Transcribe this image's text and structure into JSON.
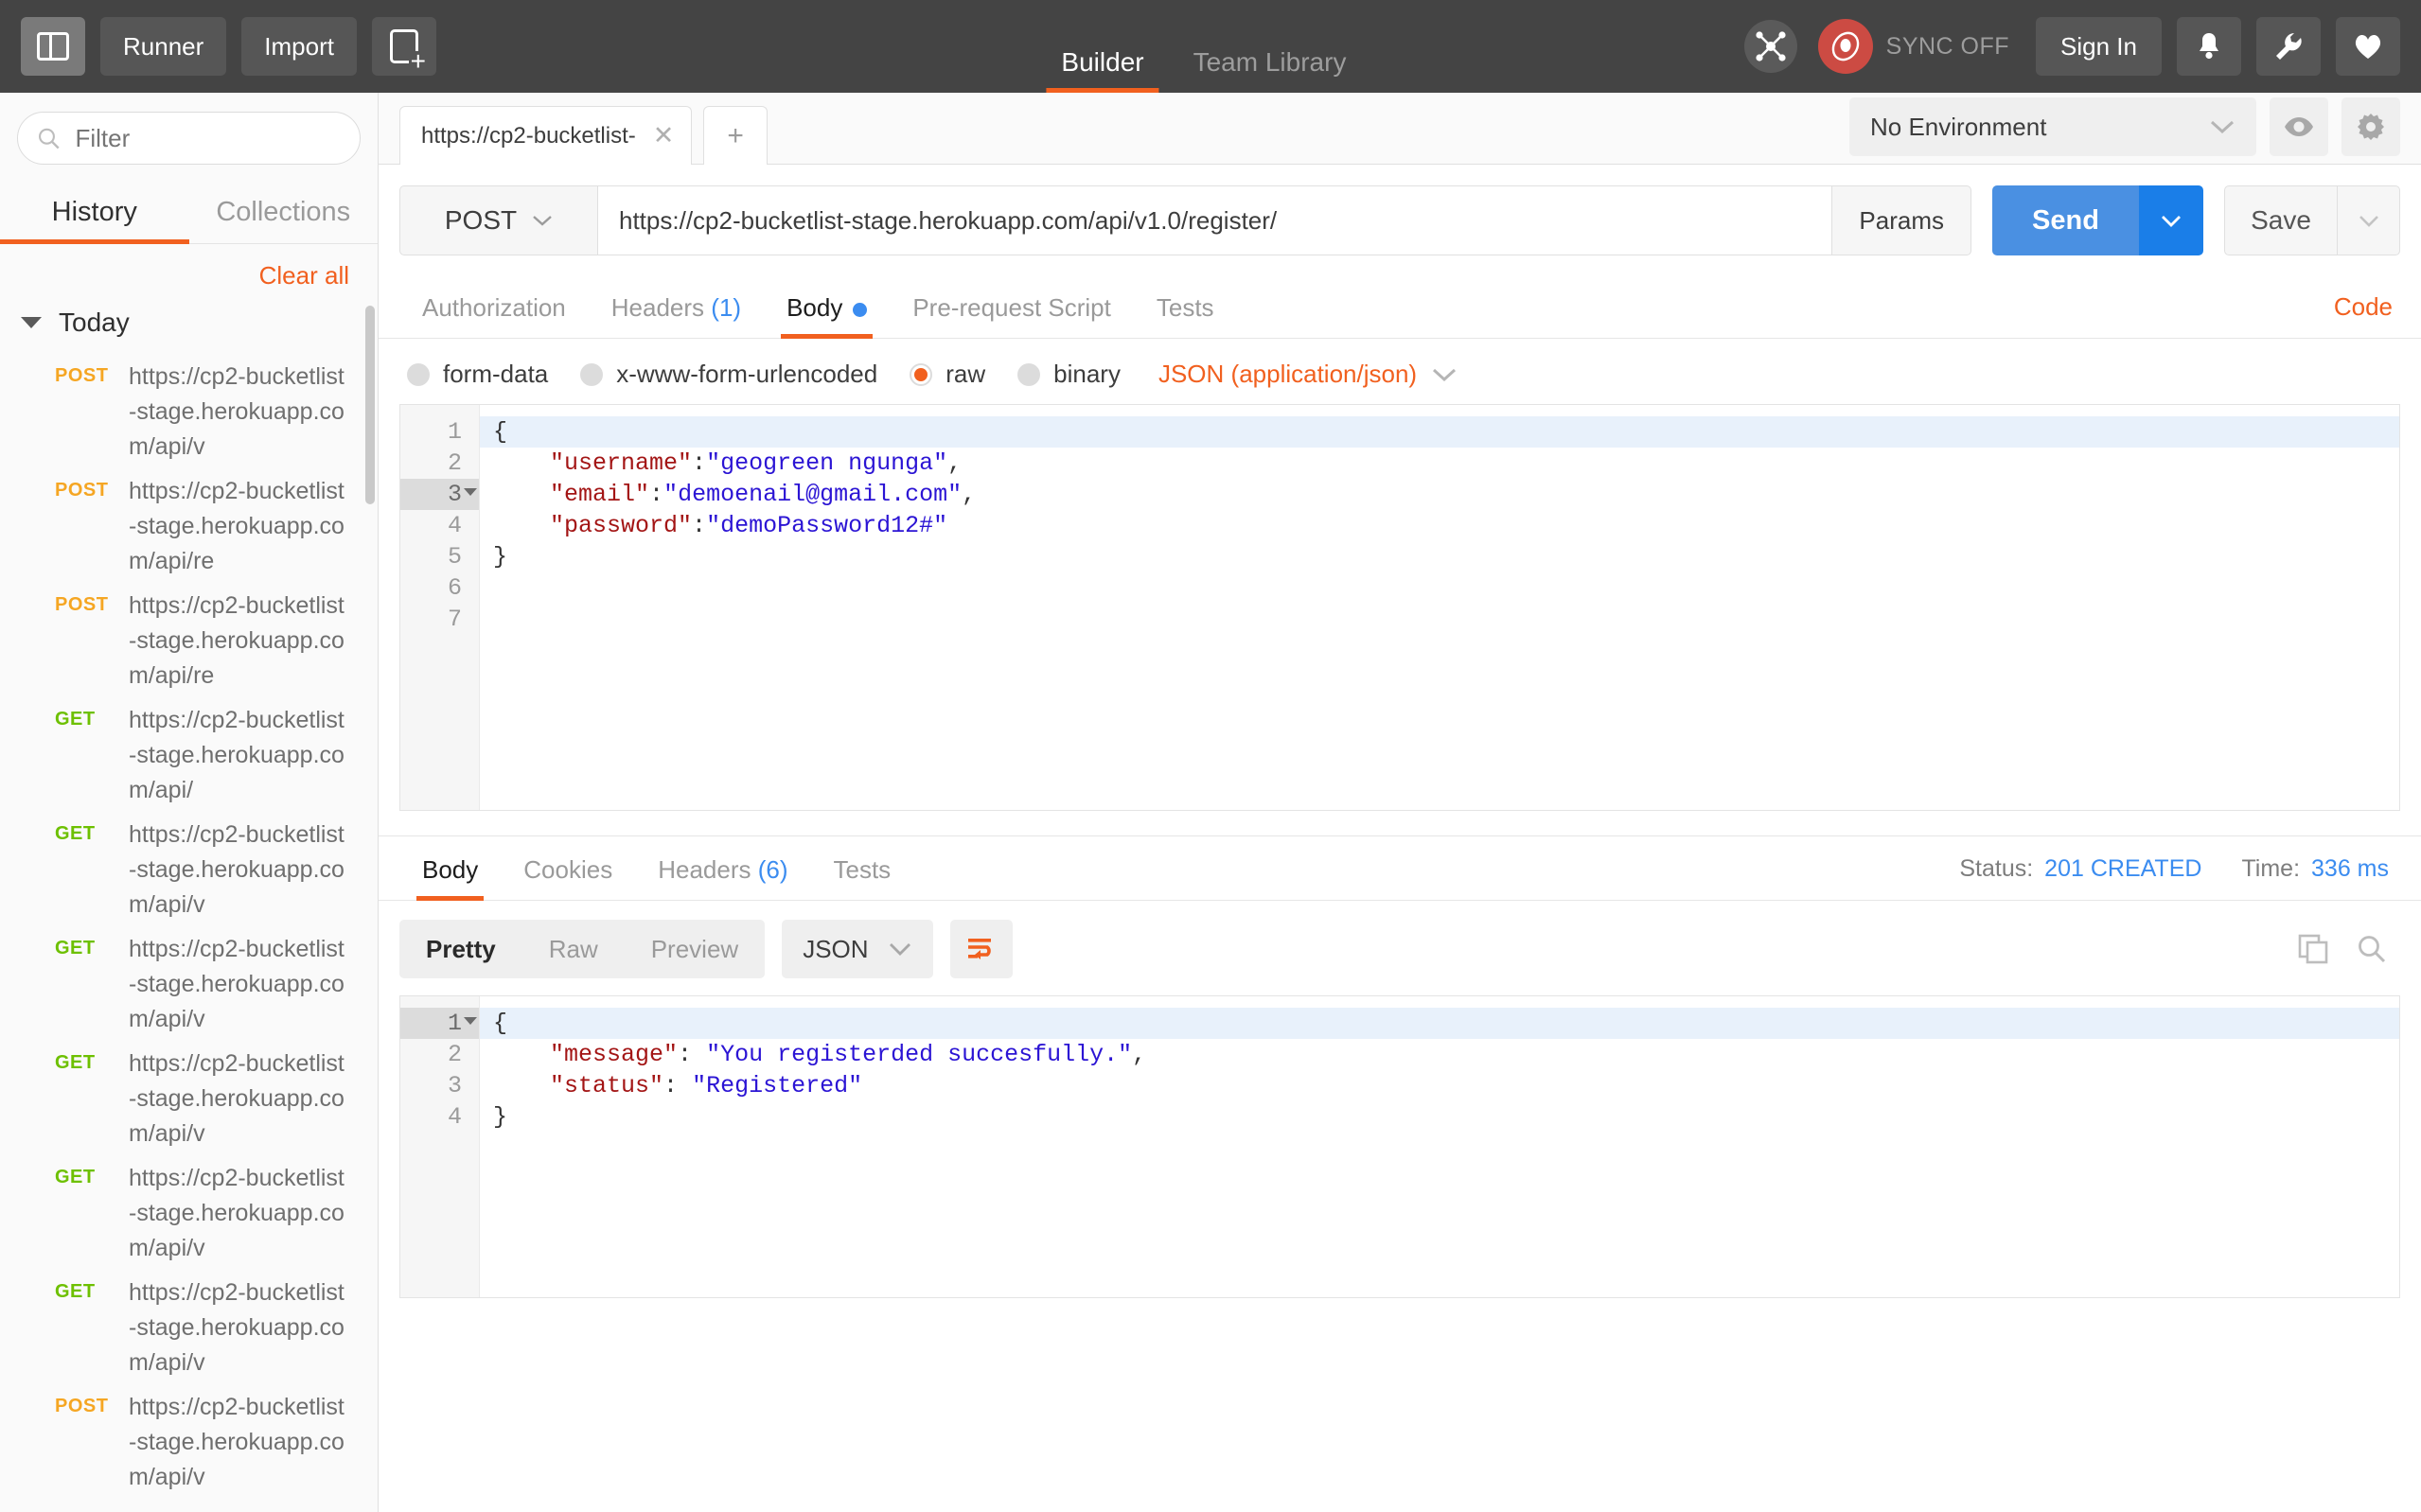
{
  "header": {
    "toggle_sidebar_icon": "panel-toggle-icon",
    "runner_label": "Runner",
    "import_label": "Import",
    "new_tab_icon": "new-request-icon",
    "tabs": [
      {
        "label": "Builder",
        "active": true
      },
      {
        "label": "Team Library",
        "active": false
      }
    ],
    "cosmo_icon": "interceptor-icon",
    "sync_icon": "sync-status-icon",
    "sync_label": "SYNC OFF",
    "signin_label": "Sign In",
    "bell_icon": "bell-icon",
    "wrench_icon": "wrench-icon",
    "heart_icon": "heart-icon"
  },
  "sidebar": {
    "search": {
      "placeholder": "Filter",
      "value": "",
      "icon": "search-icon"
    },
    "tabs": [
      {
        "label": "History",
        "active": true
      },
      {
        "label": "Collections",
        "active": false
      }
    ],
    "clear_all_label": "Clear all",
    "group_label": "Today",
    "history": [
      {
        "method": "POST",
        "url": "https://cp2-bucketlist-stage.herokuapp.com/api/v"
      },
      {
        "method": "POST",
        "url": "https://cp2-bucketlist-stage.herokuapp.com/api/re"
      },
      {
        "method": "POST",
        "url": "https://cp2-bucketlist-stage.herokuapp.com/api/re"
      },
      {
        "method": "GET",
        "url": "https://cp2-bucketlist-stage.herokuapp.com/api/"
      },
      {
        "method": "GET",
        "url": "https://cp2-bucketlist-stage.herokuapp.com/api/v"
      },
      {
        "method": "GET",
        "url": "https://cp2-bucketlist-stage.herokuapp.com/api/v"
      },
      {
        "method": "GET",
        "url": "https://cp2-bucketlist-stage.herokuapp.com/api/v"
      },
      {
        "method": "GET",
        "url": "https://cp2-bucketlist-stage.herokuapp.com/api/v"
      },
      {
        "method": "GET",
        "url": "https://cp2-bucketlist-stage.herokuapp.com/api/v"
      },
      {
        "method": "POST",
        "url": "https://cp2-bucketlist-stage.herokuapp.com/api/v"
      }
    ]
  },
  "workspace": {
    "request_tab": {
      "label": "https://cp2-bucketlist-",
      "close_icon": "close-icon"
    },
    "add_tab_icon": "plus-icon",
    "environment": {
      "value": "No Environment",
      "chevron_icon": "chevron-down-icon"
    },
    "eye_icon": "eye-icon",
    "gear_icon": "gear-icon"
  },
  "request": {
    "method": "POST",
    "method_chevron_icon": "chevron-down-icon",
    "url": "https://cp2-bucketlist-stage.herokuapp.com/api/v1.0/register/",
    "params_label": "Params",
    "send_label": "Send",
    "send_chevron_icon": "chevron-down-icon",
    "save_label": "Save",
    "save_chevron_icon": "chevron-down-icon",
    "tabs": [
      {
        "label": "Authorization",
        "count": "",
        "active": false,
        "dot": false
      },
      {
        "label": "Headers",
        "count": "(1)",
        "active": false,
        "dot": false
      },
      {
        "label": "Body",
        "count": "",
        "active": true,
        "dot": true
      },
      {
        "label": "Pre-request Script",
        "count": "",
        "active": false,
        "dot": false
      },
      {
        "label": "Tests",
        "count": "",
        "active": false,
        "dot": false
      }
    ],
    "code_link": "Code",
    "body_types": [
      {
        "label": "form-data",
        "selected": false
      },
      {
        "label": "x-www-form-urlencoded",
        "selected": false
      },
      {
        "label": "raw",
        "selected": true
      },
      {
        "label": "binary",
        "selected": false
      }
    ],
    "content_type": "JSON (application/json)",
    "content_type_chevron_icon": "chevron-down-icon",
    "body_lines": [
      {
        "n": "1",
        "text": "",
        "highlight": false,
        "fold": false
      },
      {
        "n": "2",
        "text": "",
        "highlight": false,
        "fold": false
      },
      {
        "n": "3",
        "text": "{",
        "highlight": true,
        "fold": true
      },
      {
        "n": "4",
        "key": "\"username\"",
        "sep": ":",
        "val": "\"geogreen ngunga\"",
        "tail": ",",
        "indent": true
      },
      {
        "n": "5",
        "key": "\"email\"",
        "sep": ":",
        "val": "\"demoenail@gmail.com\"",
        "tail": ",",
        "indent": true
      },
      {
        "n": "6",
        "key": "\"password\"",
        "sep": ":",
        "val": "\"demoPassword12#\"",
        "tail": "",
        "indent": true
      },
      {
        "n": "7",
        "text": "}",
        "highlight": false,
        "fold": false
      }
    ]
  },
  "response": {
    "tabs": [
      {
        "label": "Body",
        "count": "",
        "active": true
      },
      {
        "label": "Cookies",
        "count": "",
        "active": false
      },
      {
        "label": "Headers",
        "count": "(6)",
        "active": false
      },
      {
        "label": "Tests",
        "count": "",
        "active": false
      }
    ],
    "status_label": "Status:",
    "status_value": "201 CREATED",
    "time_label": "Time:",
    "time_value": "336 ms",
    "view_modes": [
      {
        "label": "Pretty",
        "active": true
      },
      {
        "label": "Raw",
        "active": false
      },
      {
        "label": "Preview",
        "active": false
      }
    ],
    "format": "JSON",
    "format_chevron_icon": "chevron-down-icon",
    "wrap_icon": "word-wrap-icon",
    "copy_icon": "copy-icon",
    "search_icon": "search-icon",
    "body_lines": [
      {
        "n": "1",
        "text": "{",
        "highlight": true,
        "fold": true
      },
      {
        "n": "2",
        "key": "\"message\"",
        "sep": ": ",
        "val": "\"You registerded succesfully.\"",
        "tail": ",",
        "indent": true
      },
      {
        "n": "3",
        "key": "\"status\"",
        "sep": ": ",
        "val": "\"Registered\"",
        "tail": "",
        "indent": true
      },
      {
        "n": "4",
        "text": "}",
        "highlight": false,
        "fold": false
      }
    ]
  },
  "colors": {
    "accent_orange": "#f1601f",
    "blue": "#3b8cf0",
    "send_blue": "#4a90e2",
    "get_green": "#6dc000",
    "post_orange": "#f5a623",
    "header_dark": "#444444"
  }
}
